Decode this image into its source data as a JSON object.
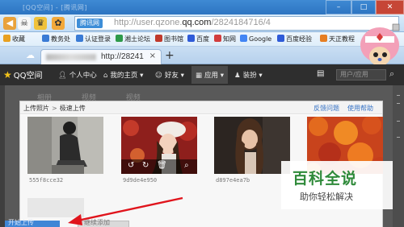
{
  "browser": {
    "title_text": "[QQ空间] - [腾讯网]",
    "address": {
      "badge": "腾讯网",
      "url_prefix": "http://user.qzone.",
      "url_domain": "qq.com",
      "url_suffix": "/2824184716/4"
    },
    "bookmarks": [
      {
        "label": "收藏",
        "color": "#e8a020"
      },
      {
        "label": "教务处",
        "color": "#3a7bd5"
      },
      {
        "label": "认证登录",
        "color": "#3a7bd5"
      },
      {
        "label": "湘土论坛",
        "color": "#2e9a4a"
      },
      {
        "label": "图书馆",
        "color": "#c0392b"
      },
      {
        "label": "百度",
        "color": "#2f5bd8"
      },
      {
        "label": "知网",
        "color": "#d23d3d"
      },
      {
        "label": "Google",
        "color": "#4285f4"
      },
      {
        "label": "百度经验",
        "color": "#2f5bd8"
      },
      {
        "label": "天正教程",
        "color": "#e67e22"
      }
    ],
    "tab": {
      "title": "http://28241",
      "close": "×",
      "new_tab": "+"
    }
  },
  "qzone_nav": {
    "logo": "QQ空间",
    "items": [
      {
        "label": "个人中心",
        "icon": "person-icon"
      },
      {
        "label": "我的主页",
        "icon": "home-icon"
      },
      {
        "label": "好友",
        "icon": "friends-icon"
      },
      {
        "label": "应用",
        "icon": "apps-icon"
      },
      {
        "label": "装扮",
        "icon": "shirt-icon"
      }
    ],
    "search_placeholder": "用户/应用"
  },
  "background_tabs": [
    "相册",
    "视频",
    "视频"
  ],
  "dialog": {
    "breadcrumb_root": "上传照片",
    "breadcrumb_sep": ">",
    "breadcrumb_current": "极速上传",
    "feedback_link": "反馈问题",
    "help_link": "使用帮助",
    "photos": [
      {
        "caption": "555f8cce32"
      },
      {
        "caption": "9d9de4e950"
      },
      {
        "caption": "d897e4ea7b"
      },
      {
        "caption": ""
      }
    ],
    "upload_button": "开始上传",
    "secondary_button": "继续添加"
  },
  "watermark": {
    "title": "百科全说",
    "subtitle": "助你轻松解决"
  }
}
